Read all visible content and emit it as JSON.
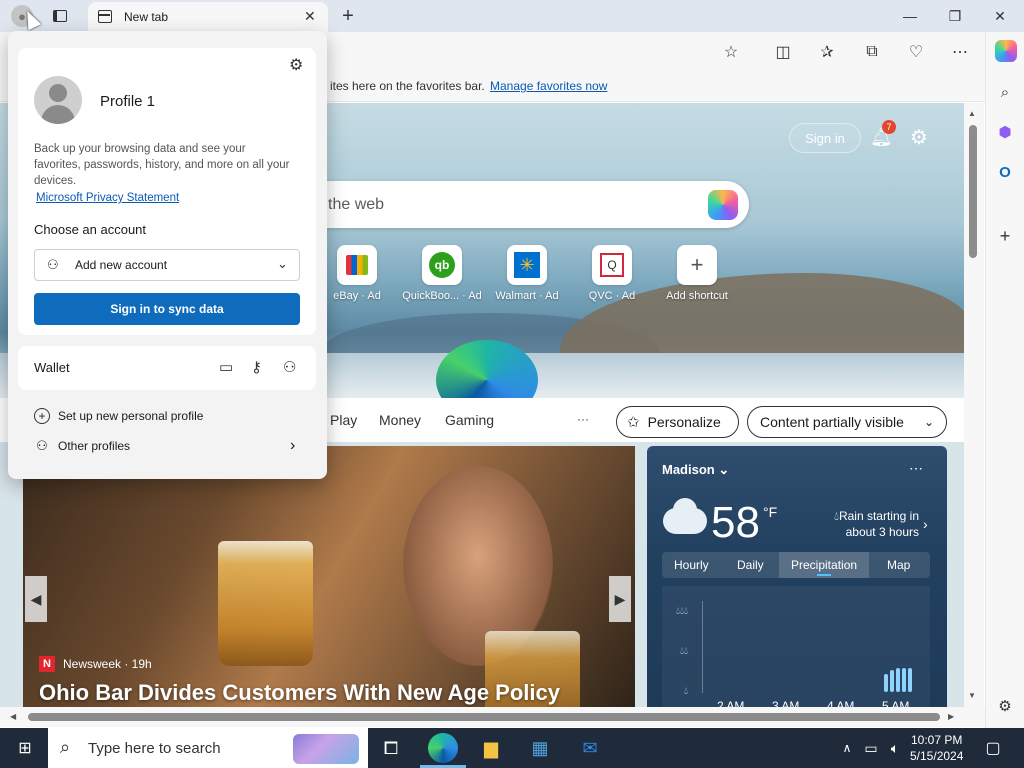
{
  "browser": {
    "tab_title": "New tab",
    "favorites_bar_text": "ites here on the favorites bar.",
    "favorites_bar_link": "Manage favorites now"
  },
  "newtab": {
    "sign_in": "Sign in",
    "notification_count": "7",
    "search_placeholder": "the web",
    "shortcuts": [
      {
        "label": "eBay · Ad",
        "icon": "ebay-bag-icon"
      },
      {
        "label": "QuickBoo... · Ad",
        "icon": "quickbooks-icon"
      },
      {
        "label": "Walmart · Ad",
        "icon": "walmart-icon"
      },
      {
        "label": "QVC · Ad",
        "icon": "qvc-icon"
      },
      {
        "label": "Add shortcut",
        "icon": "plus-icon"
      }
    ],
    "nav": [
      "Play",
      "Money",
      "Gaming"
    ],
    "more": "···",
    "personalize": "Personalize",
    "content_visibility": "Content partially visible"
  },
  "news": {
    "source": "Newsweek · 19h",
    "source_logo": "N",
    "headline": "Ohio Bar Divides Customers With New Age Policy"
  },
  "weather": {
    "city": "Madison",
    "temp": "58",
    "unit": "°F",
    "rain_line1": "Rain starting in",
    "rain_line2": "about 3 hours",
    "tabs": [
      "Hourly",
      "Daily",
      "Precipitation",
      "Map"
    ],
    "selected_tab": "Precipitation",
    "times": [
      "2 AM",
      "3 AM",
      "4 AM",
      "5 AM"
    ]
  },
  "profile_flyout": {
    "name": "Profile 1",
    "description": "Back up your browsing data and see your favorites, passwords, history, and more on all your devices.",
    "privacy_link": "Microsoft Privacy Statement",
    "choose_account": "Choose an account",
    "add_account": "Add new account",
    "sync_button": "Sign in to sync data",
    "wallet": "Wallet",
    "new_profile": "Set up new personal profile",
    "other_profiles": "Other profiles"
  },
  "taskbar": {
    "search_placeholder": "Type here to search",
    "time": "10:07 PM",
    "date": "5/15/2024"
  },
  "colors": {
    "accent": "#0f6cbd",
    "notification_badge": "#e3452d",
    "taskbar": "#1f2b3a"
  }
}
